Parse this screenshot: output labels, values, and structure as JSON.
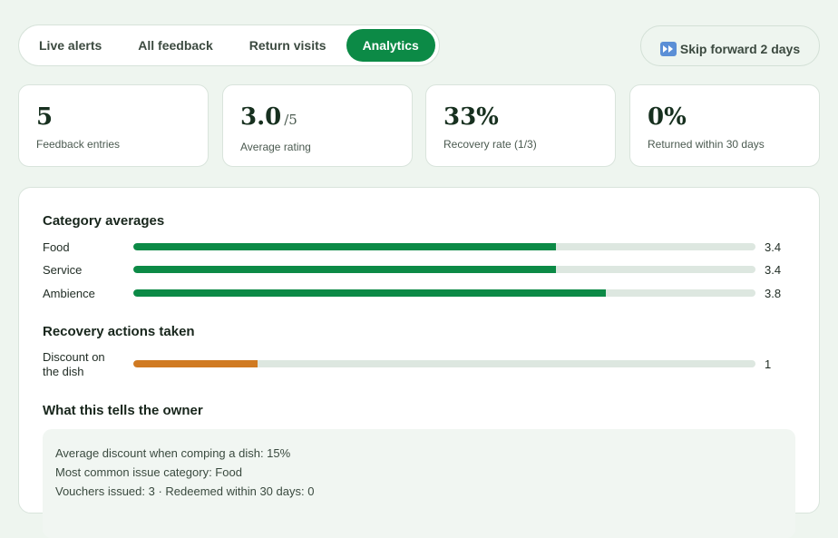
{
  "tabs": [
    {
      "label": "Live alerts",
      "active": false
    },
    {
      "label": "All feedback",
      "active": false
    },
    {
      "label": "Return visits",
      "active": false
    },
    {
      "label": "Analytics",
      "active": true
    }
  ],
  "skip_button": {
    "icon": "fast-forward-icon",
    "label": "Skip forward 2 days"
  },
  "stats": [
    {
      "value": "5",
      "suffix": "",
      "label": "Feedback entries"
    },
    {
      "value": "3.0",
      "suffix": "/5",
      "label": "Average rating"
    },
    {
      "value": "33%",
      "suffix": "",
      "label": "Recovery rate (1/3)"
    },
    {
      "value": "0%",
      "suffix": "",
      "label": "Returned within 30 days"
    }
  ],
  "category_section": {
    "title": "Category averages",
    "max": 5,
    "items": [
      {
        "label": "Food",
        "value": 3.4,
        "display": "3.4"
      },
      {
        "label": "Service",
        "value": 3.4,
        "display": "3.4"
      },
      {
        "label": "Ambience",
        "value": 3.8,
        "display": "3.8"
      }
    ]
  },
  "recovery_section": {
    "title": "Recovery actions taken",
    "max": 5,
    "items": [
      {
        "label": "Discount on the dish",
        "value": 1,
        "display": "1"
      }
    ]
  },
  "owner_section": {
    "title": "What this tells the owner",
    "lines": [
      "Average discount when comping a dish: 15%",
      "Most common issue category: Food",
      "Vouchers issued: 3 · Redeemed within 30 days: 0"
    ]
  },
  "colors": {
    "accent": "#0c8a46",
    "recovery": "#d07a22",
    "track": "#dde7e0"
  }
}
